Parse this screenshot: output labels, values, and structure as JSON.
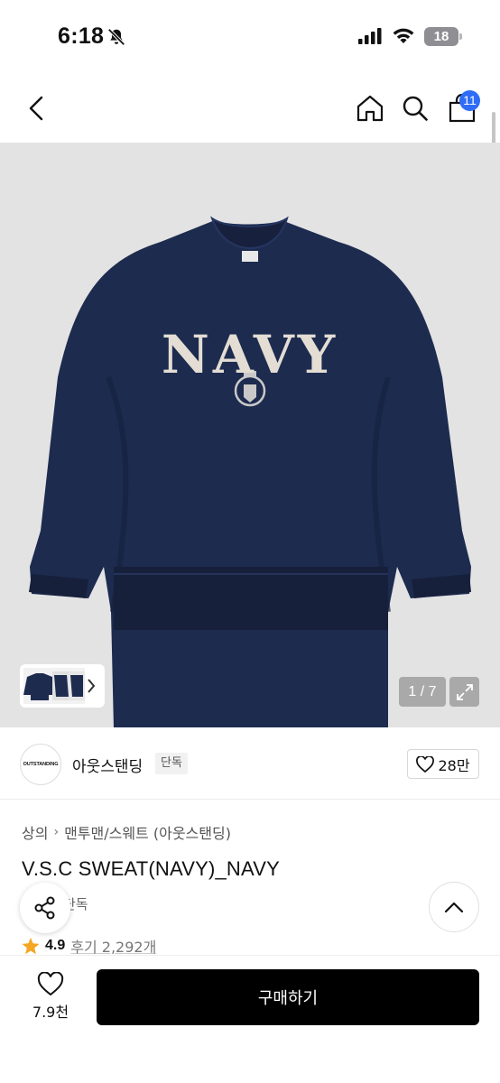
{
  "status": {
    "time": "6:18",
    "battery": "18"
  },
  "nav": {
    "cart_count": "11"
  },
  "gallery": {
    "page_counter": "1 / 7",
    "graphic_text": "NAVY"
  },
  "brand": {
    "logo_text": "OUTSTANDING",
    "name": "아웃스탠딩",
    "exclusive_label": "단독",
    "like_count": "28만"
  },
  "product": {
    "breadcrumb": [
      "상의",
      "맨투맨/스웨트 (아웃스탠딩)"
    ],
    "title": "V.S.C SWEAT(NAVY)_NAVY",
    "sub_badge": "단독",
    "rating": "4.9",
    "reviews": "후기 2,292개"
  },
  "bottom": {
    "wish_count": "7.9천",
    "buy_label": "구매하기"
  },
  "colors": {
    "accent": "#2f6df6",
    "sweat_navy": "#1d2b4f",
    "buy_button": "#000000"
  }
}
